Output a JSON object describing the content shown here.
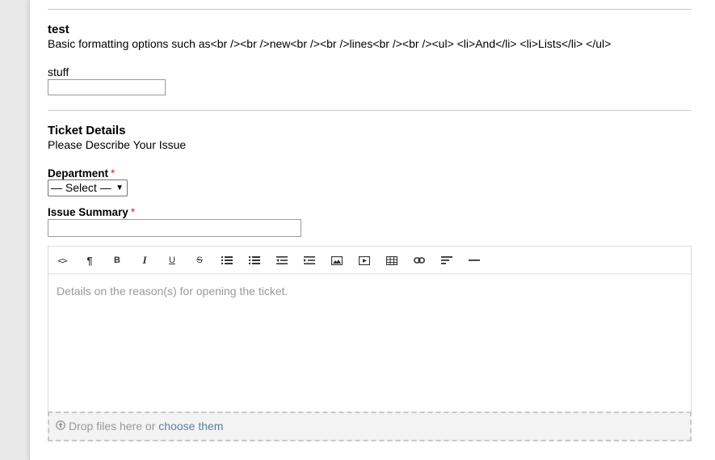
{
  "sections": [
    {
      "title": "test",
      "description": "Basic formatting options such as<br /><br />new<br /><br />lines<br /><br /><ul> <li>And</li> <li>Lists</li> </ul>",
      "fields": [
        {
          "label": "stuff",
          "value": "",
          "placeholder": ""
        }
      ]
    },
    {
      "title": "Ticket Details",
      "description": "Please Describe Your Issue",
      "department": {
        "label": "Department",
        "required_mark": "*",
        "selected": "— Select —"
      },
      "issue_summary": {
        "label": "Issue Summary",
        "required_mark": "*",
        "value": ""
      },
      "editor": {
        "placeholder": "Details on the reason(s) for opening the ticket.",
        "toolbar": [
          "code-view-icon",
          "paragraph-icon",
          "bold-icon",
          "italic-icon",
          "underline-icon",
          "strikethrough-icon",
          "bullet-list-icon",
          "numbered-list-icon",
          "outdent-icon",
          "indent-icon",
          "image-icon",
          "video-icon",
          "table-icon",
          "link-icon",
          "align-left-icon",
          "horizontal-rule-icon"
        ],
        "toolbar_glyphs": {
          "code": "<>",
          "paragraph": "¶",
          "bold": "B",
          "italic": "I",
          "underline": "U",
          "strikethrough": "S"
        }
      },
      "dropzone": {
        "text": "Drop files here or ",
        "link": "choose them"
      }
    }
  ],
  "colors": {
    "required": "#dd2222",
    "link": "#5a7fa8",
    "placeholder": "#999999"
  }
}
